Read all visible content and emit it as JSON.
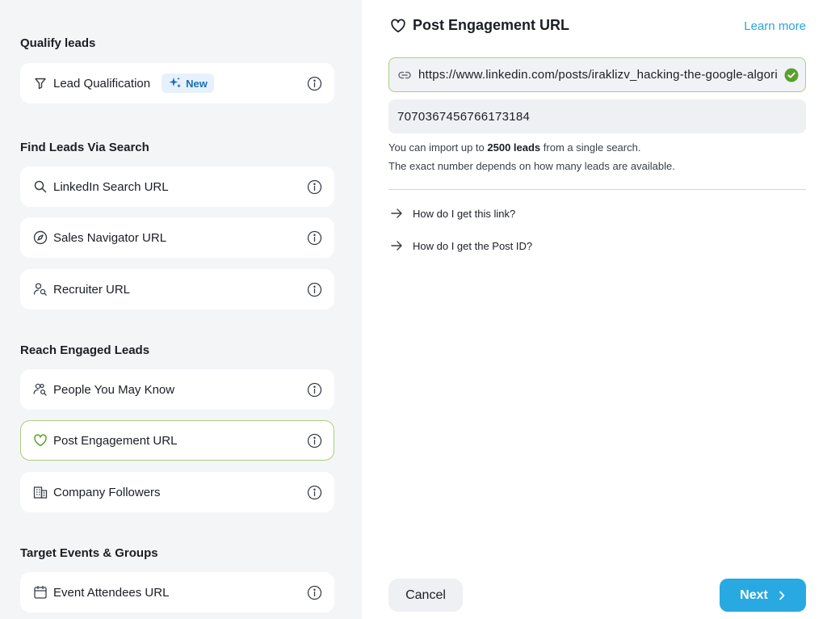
{
  "sidebar": {
    "sections": [
      {
        "title": "Qualify leads"
      },
      {
        "title": "Find Leads Via Search"
      },
      {
        "title": "Reach Engaged Leads"
      },
      {
        "title": "Target Events & Groups"
      }
    ],
    "items": [
      {
        "label": "Lead Qualification",
        "icon": "filter-icon",
        "badge": "New"
      },
      {
        "label": "LinkedIn Search URL",
        "icon": "search-icon"
      },
      {
        "label": "Sales Navigator URL",
        "icon": "compass-icon"
      },
      {
        "label": "Recruiter URL",
        "icon": "user-search-icon"
      },
      {
        "label": "People You May Know",
        "icon": "users-search-icon"
      },
      {
        "label": "Post Engagement URL",
        "icon": "heart-icon",
        "selected": true
      },
      {
        "label": "Company Followers",
        "icon": "building-icon"
      },
      {
        "label": "Event Attendees URL",
        "icon": "calendar-icon"
      }
    ]
  },
  "panel": {
    "title": "Post Engagement URL",
    "learn_more": "Learn more",
    "url_value": "https://www.linkedin.com/posts/iraklizv_hacking-the-google-algorithm",
    "post_id_value": "7070367456766173184",
    "help_prefix": "You can import up to ",
    "help_bold": "2500 leads",
    "help_suffix": " from a single search.",
    "help_line2": "The exact number depends on how many leads are available.",
    "faq": [
      {
        "label": "How do I get this link?"
      },
      {
        "label": "How do I get the Post ID?"
      }
    ],
    "cancel_label": "Cancel",
    "next_label": "Next"
  },
  "colors": {
    "accent": "#29a9e1",
    "selected_border": "#a8cf7e",
    "badge_bg": "#e6f1fb",
    "badge_text": "#1a6fb8",
    "success": "#5aa02c"
  }
}
